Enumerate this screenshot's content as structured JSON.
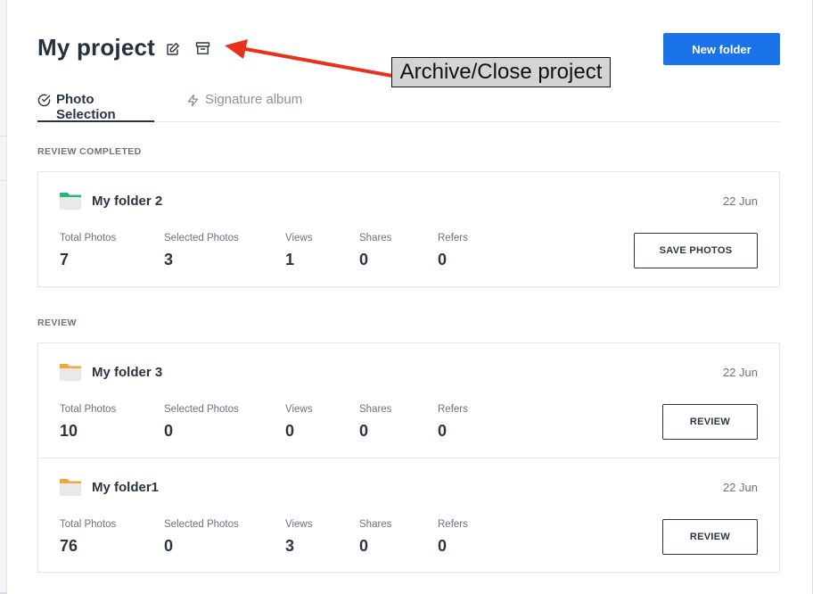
{
  "header": {
    "title": "My project",
    "new_folder_label": "New folder"
  },
  "annotation": {
    "text": "Archive/Close project"
  },
  "tabs": [
    {
      "label": "Photo Selection",
      "icon": "check-circle-icon",
      "active": true
    },
    {
      "label": "Signature album",
      "icon": "lightning-icon",
      "active": false
    }
  ],
  "sections": [
    {
      "label": "REVIEW COMPLETED",
      "folders": [
        {
          "name": "My folder 2",
          "date": "22 Jun",
          "folder_color": "#2bb673",
          "stats": [
            {
              "label": "Total Photos",
              "value": "7"
            },
            {
              "label": "Selected Photos",
              "value": "3"
            },
            {
              "label": "Views",
              "value": "1"
            },
            {
              "label": "Shares",
              "value": "0"
            },
            {
              "label": "Refers",
              "value": "0"
            }
          ],
          "action_label": "SAVE PHOTOS"
        }
      ]
    },
    {
      "label": "REVIEW",
      "folders": [
        {
          "name": "My folder 3",
          "date": "22 Jun",
          "folder_color": "#f2a73b",
          "stats": [
            {
              "label": "Total Photos",
              "value": "10"
            },
            {
              "label": "Selected Photos",
              "value": "0"
            },
            {
              "label": "Views",
              "value": "0"
            },
            {
              "label": "Shares",
              "value": "0"
            },
            {
              "label": "Refers",
              "value": "0"
            }
          ],
          "action_label": "REVIEW"
        },
        {
          "name": "My folder1",
          "date": "22 Jun",
          "folder_color": "#f2a73b",
          "stats": [
            {
              "label": "Total Photos",
              "value": "76"
            },
            {
              "label": "Selected Photos",
              "value": "0"
            },
            {
              "label": "Views",
              "value": "3"
            },
            {
              "label": "Shares",
              "value": "0"
            },
            {
              "label": "Refers",
              "value": "0"
            }
          ],
          "action_label": "REVIEW"
        }
      ]
    }
  ],
  "colors": {
    "accent": "#1a73e8",
    "text_dark": "#2a3442",
    "text_muted": "#6b7380",
    "annotation_arrow": "#e8311f"
  }
}
